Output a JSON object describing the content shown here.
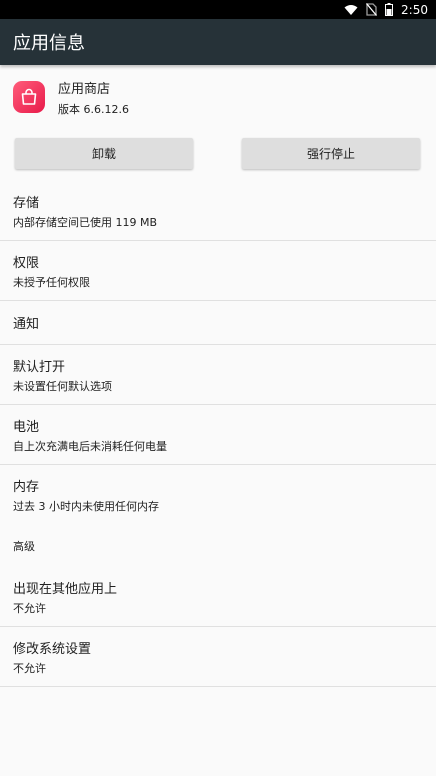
{
  "status_bar": {
    "time": "2:50",
    "icons": [
      "wifi-icon",
      "no-sim-icon",
      "battery-icon"
    ]
  },
  "toolbar": {
    "title": "应用信息"
  },
  "app": {
    "name": "应用商店",
    "version": "版本 6.6.12.6",
    "icon": "shopping-bag-icon",
    "icon_color": "#f0305a"
  },
  "buttons": {
    "uninstall": "卸载",
    "force_stop": "强行停止"
  },
  "settings": [
    {
      "title": "存储",
      "subtitle": "内部存储空间已使用 119 MB"
    },
    {
      "title": "权限",
      "subtitle": "未授予任何权限"
    },
    {
      "title": "通知"
    },
    {
      "title": "默认打开",
      "subtitle": "未设置任何默认选项"
    },
    {
      "title": "电池",
      "subtitle": "自上次充满电后未消耗任何电量"
    },
    {
      "title": "内存",
      "subtitle": "过去 3 小时内未使用任何内存"
    }
  ],
  "advanced": {
    "header": "高级",
    "items": [
      {
        "title": "出现在其他应用上",
        "subtitle": "不允许"
      },
      {
        "title": "修改系统设置",
        "subtitle": "不允许"
      }
    ]
  },
  "colors": {
    "toolbar": "#263238",
    "status_bar": "#000000",
    "background": "#fafafa",
    "button": "#dedede"
  }
}
